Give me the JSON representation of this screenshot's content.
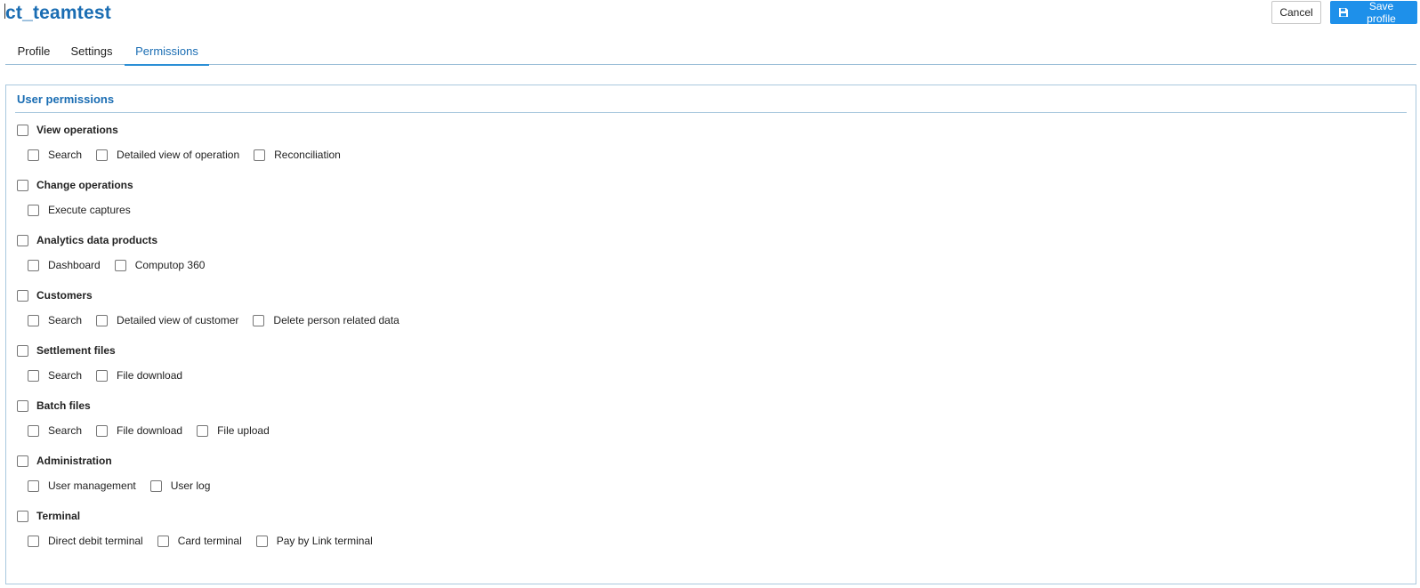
{
  "header": {
    "title": "ct_teamtest",
    "cancel_label": "Cancel",
    "save_label": "Save profile",
    "save_icon": "floppy-disk-icon"
  },
  "tabs": [
    {
      "label": "Profile",
      "active": false
    },
    {
      "label": "Settings",
      "active": false
    },
    {
      "label": "Permissions",
      "active": true
    }
  ],
  "permissions": {
    "title": "User permissions",
    "groups": [
      {
        "label": "View operations",
        "checked": false,
        "items": [
          {
            "label": "Search",
            "checked": false
          },
          {
            "label": "Detailed view of operation",
            "checked": false
          },
          {
            "label": "Reconciliation",
            "checked": false
          }
        ]
      },
      {
        "label": "Change operations",
        "checked": false,
        "items": [
          {
            "label": "Execute captures",
            "checked": false
          }
        ]
      },
      {
        "label": "Analytics data products",
        "checked": false,
        "items": [
          {
            "label": "Dashboard",
            "checked": false
          },
          {
            "label": "Computop 360",
            "checked": false
          }
        ]
      },
      {
        "label": "Customers",
        "checked": false,
        "items": [
          {
            "label": "Search",
            "checked": false
          },
          {
            "label": "Detailed view of customer",
            "checked": false
          },
          {
            "label": "Delete person related data",
            "checked": false
          }
        ]
      },
      {
        "label": "Settlement files",
        "checked": false,
        "items": [
          {
            "label": "Search",
            "checked": false
          },
          {
            "label": "File download",
            "checked": false
          }
        ]
      },
      {
        "label": "Batch files",
        "checked": false,
        "items": [
          {
            "label": "Search",
            "checked": false
          },
          {
            "label": "File download",
            "checked": false
          },
          {
            "label": "File upload",
            "checked": false
          }
        ]
      },
      {
        "label": "Administration",
        "checked": false,
        "items": [
          {
            "label": "User management",
            "checked": false
          },
          {
            "label": "User log",
            "checked": false
          }
        ]
      },
      {
        "label": "Terminal",
        "checked": false,
        "items": [
          {
            "label": "Direct debit terminal",
            "checked": false
          },
          {
            "label": "Card terminal",
            "checked": false
          },
          {
            "label": "Pay by Link terminal",
            "checked": false
          }
        ]
      }
    ]
  },
  "colors": {
    "accent": "#1a6db3",
    "primary_button": "#1e90ea",
    "border": "#a9c8de"
  }
}
